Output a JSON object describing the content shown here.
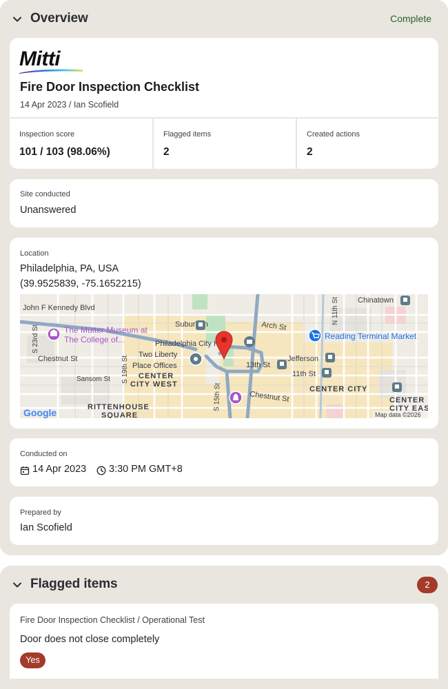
{
  "overview": {
    "title": "Overview",
    "status": "Complete",
    "logo_text": "Mitti",
    "doc_title": "Fire Door Inspection Checklist",
    "doc_subtitle": "14 Apr 2023 / Ian Scofield",
    "stats": [
      {
        "label": "Inspection score",
        "value": "101 / 103 (98.06%)"
      },
      {
        "label": "Flagged items",
        "value": "2"
      },
      {
        "label": "Created actions",
        "value": "2"
      }
    ],
    "site": {
      "label": "Site conducted",
      "value": "Unanswered"
    },
    "location": {
      "label": "Location",
      "address": "Philadelphia, PA, USA",
      "coords": "(39.9525839, -75.1652215)"
    },
    "conducted": {
      "label": "Conducted on",
      "date": "14 Apr 2023",
      "time": "3:30 PM GMT+8"
    },
    "prepared": {
      "label": "Prepared by",
      "value": "Ian Scofield"
    }
  },
  "map": {
    "labels": {
      "jfk": "John F Kennedy Blvd",
      "chinatown": "Chinatown",
      "n11": "N 11th St",
      "suburban": "Suburban",
      "arch": "Arch St",
      "mutter1": "The Mütter Museum at",
      "mutter2": "The College of...",
      "cityhall": "Philadelphia City Hall",
      "reading": "Reading Terminal Market",
      "s23": "S 23rd St",
      "chestnut_w": "Chestnut St",
      "s19": "S 19th St",
      "twoliberty1": "Two Liberty",
      "twoliberty2": "Place Offices",
      "s13": "13th St",
      "jefferson": "Jefferson",
      "s11": "11th St",
      "cc_west1": "CENTER",
      "cc_west2": "CITY WEST",
      "sansom": "Sansom St",
      "s15": "S 15th St",
      "chestnut_e": "Chestnut St",
      "center_city": "CENTER CITY",
      "cc_east1": "CENTER",
      "cc_east2": "CITY EAST",
      "rittenhouse1": "RITTENHOUSE",
      "rittenhouse2": "SQUARE",
      "google": "Google",
      "attribution": "Map data ©2026"
    },
    "colors": {
      "pin": "#e8342b",
      "poi_purple": "#a855c8",
      "poi_blue": "#1a73e8",
      "transit": "#5f7a8a"
    }
  },
  "flagged": {
    "title": "Flagged items",
    "count": "2",
    "item": {
      "path": "Fire Door Inspection Checklist / Operational Test",
      "question": "Door does not close completely",
      "answer": "Yes"
    }
  },
  "colors": {
    "panel_bg": "#e9e6e0",
    "status_green": "#2f5e27",
    "badge_red": "#a33a2a"
  },
  "icons": [
    "chevron-down-icon",
    "calendar-icon",
    "clock-icon",
    "map-pin-icon",
    "museum-icon",
    "shopping-cart-icon",
    "train-icon"
  ]
}
